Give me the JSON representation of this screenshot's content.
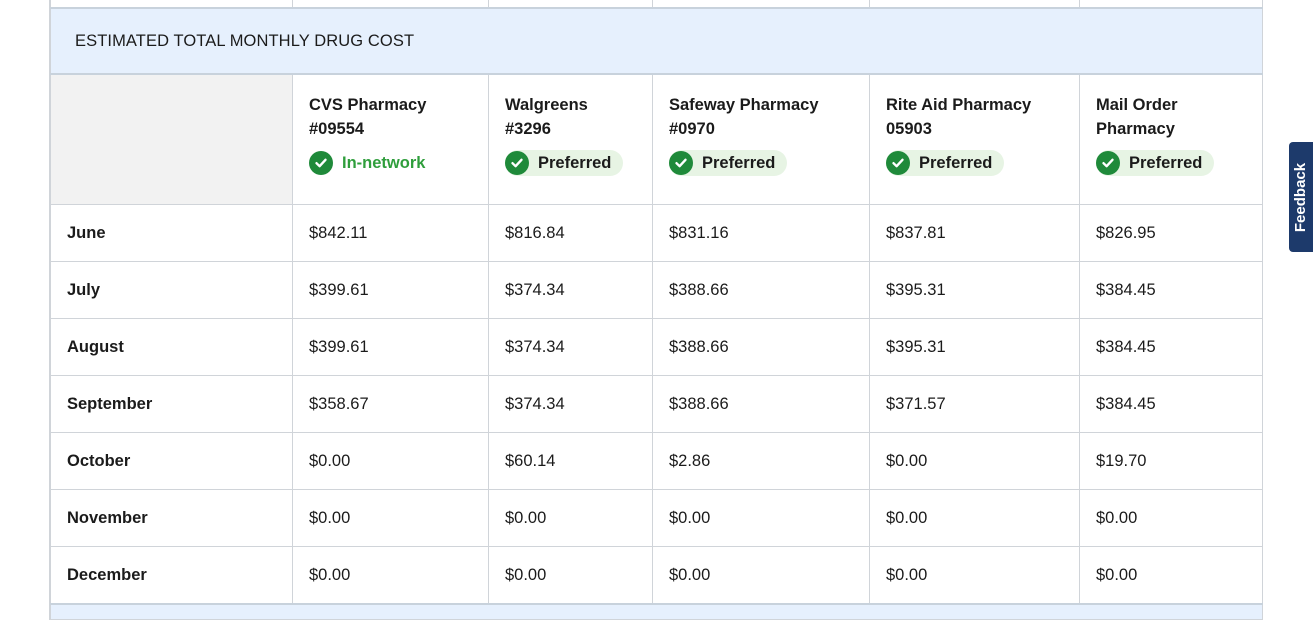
{
  "section_title": "ESTIMATED TOTAL MONTHLY DRUG COST",
  "pharmacies": [
    {
      "name": "CVS Pharmacy #09554",
      "status": "In-network",
      "status_type": "in-network"
    },
    {
      "name": "Walgreens #3296",
      "status": "Preferred",
      "status_type": "preferred"
    },
    {
      "name": "Safeway Pharmacy #0970",
      "status": "Preferred",
      "status_type": "preferred"
    },
    {
      "name": "Rite Aid Pharmacy 05903",
      "status": "Preferred",
      "status_type": "preferred"
    },
    {
      "name": "Mail Order Pharmacy",
      "status": "Preferred",
      "status_type": "preferred"
    }
  ],
  "rows": [
    {
      "month": "June",
      "costs": [
        "$842.11",
        "$816.84",
        "$831.16",
        "$837.81",
        "$826.95"
      ]
    },
    {
      "month": "July",
      "costs": [
        "$399.61",
        "$374.34",
        "$388.66",
        "$395.31",
        "$384.45"
      ]
    },
    {
      "month": "August",
      "costs": [
        "$399.61",
        "$374.34",
        "$388.66",
        "$395.31",
        "$384.45"
      ]
    },
    {
      "month": "September",
      "costs": [
        "$358.67",
        "$374.34",
        "$388.66",
        "$371.57",
        "$384.45"
      ]
    },
    {
      "month": "October",
      "costs": [
        "$0.00",
        "$60.14",
        "$2.86",
        "$0.00",
        "$19.70"
      ]
    },
    {
      "month": "November",
      "costs": [
        "$0.00",
        "$0.00",
        "$0.00",
        "$0.00",
        "$0.00"
      ]
    },
    {
      "month": "December",
      "costs": [
        "$0.00",
        "$0.00",
        "$0.00",
        "$0.00",
        "$0.00"
      ]
    }
  ],
  "feedback_label": "Feedback",
  "colors": {
    "header_bg": "#e6f0fd",
    "preferred_bg": "#e7f4e4",
    "check_green": "#1f8a3a",
    "feedback_bg": "#1d3a6b"
  },
  "icons": {
    "status": "check-circle-icon"
  }
}
